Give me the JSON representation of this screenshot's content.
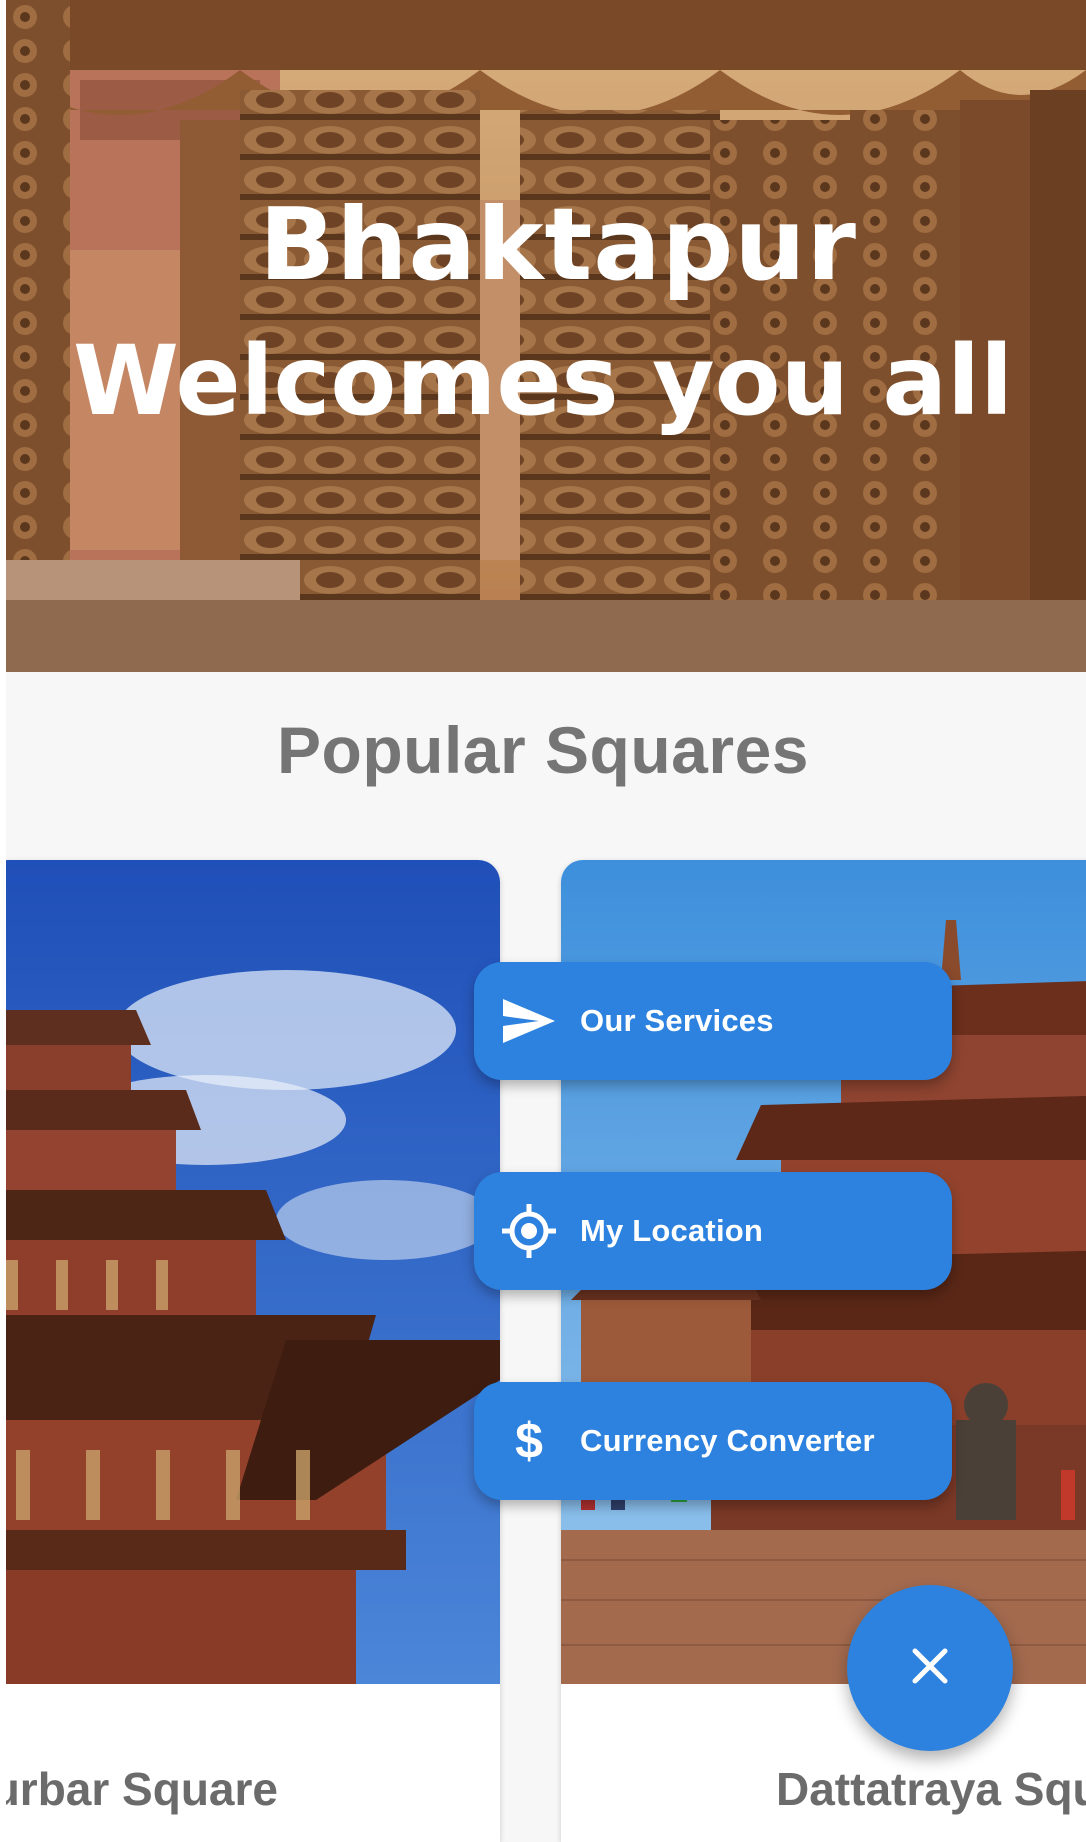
{
  "hero": {
    "title_line1": "Bhaktapur",
    "title_line2": "Welcomes you all"
  },
  "popular": {
    "heading": "Popular Squares",
    "cards": [
      {
        "title": "Durbar Square"
      },
      {
        "title": "Dattatraya Squ"
      }
    ]
  },
  "speed_dial": {
    "actions": [
      {
        "label": "Our Services",
        "icon": "send-icon"
      },
      {
        "label": "My Location",
        "icon": "location-target-icon"
      },
      {
        "label": "Currency Converter",
        "icon": "dollar-icon",
        "glyph": "$"
      }
    ],
    "close_icon": "close-icon"
  },
  "colors": {
    "accent": "#2c82de",
    "heading_text": "#757575",
    "card_title_text": "#6b6b6b",
    "background": "#f7f7f7"
  }
}
